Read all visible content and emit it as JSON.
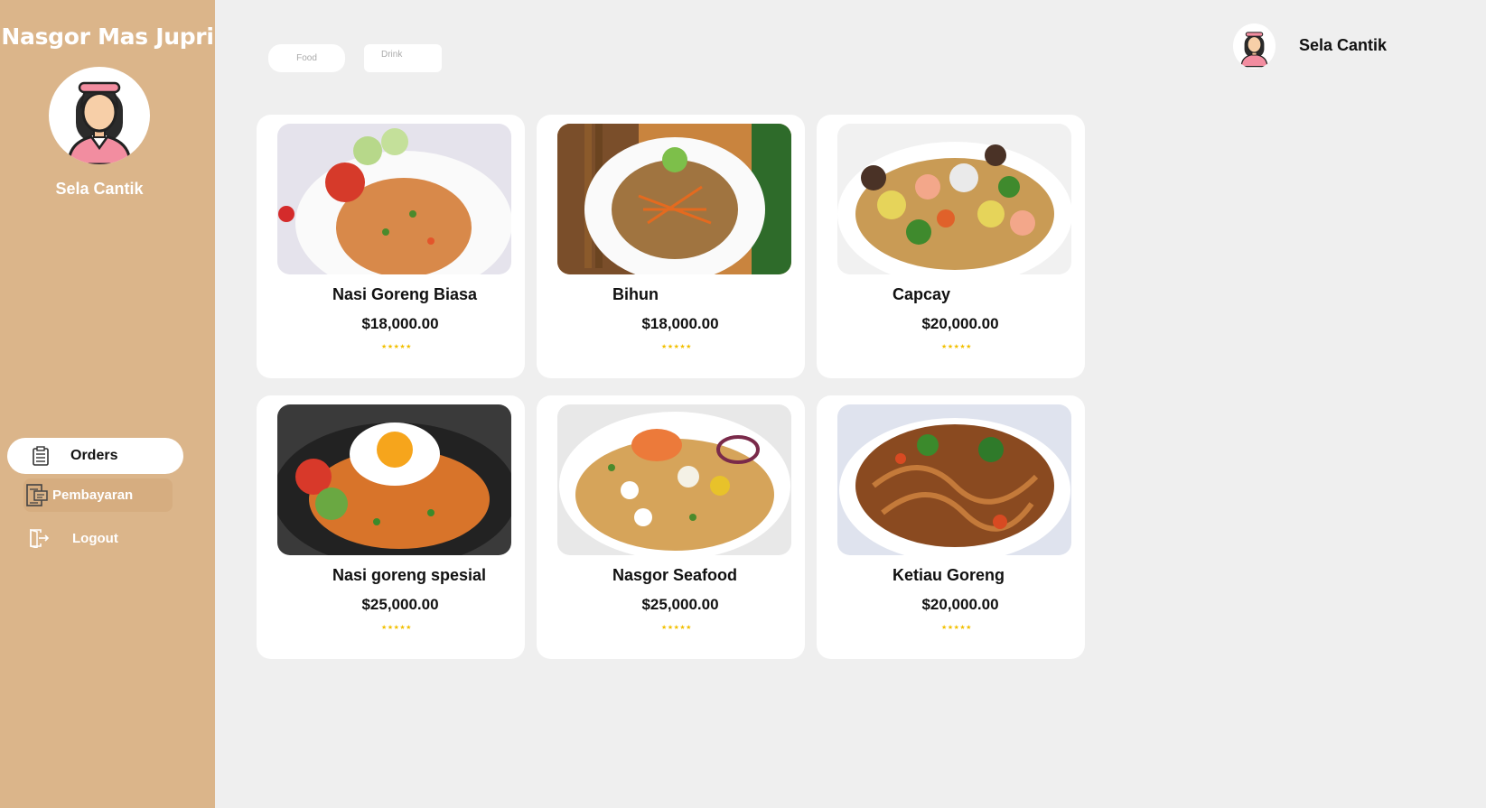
{
  "sidebar": {
    "app_title": "Nasgor Mas Jupri",
    "user_name": "Sela Cantik",
    "nav": [
      {
        "label": "Orders",
        "icon": "clipboard-icon"
      },
      {
        "label": "Pembayaran",
        "icon": "receipt-icon"
      },
      {
        "label": "Logout",
        "icon": "logout-icon"
      }
    ]
  },
  "filters": {
    "food": "Food",
    "drink": "Drink"
  },
  "header": {
    "user_name": "Sela Cantik"
  },
  "menu": [
    {
      "name": "Nasi Goreng Biasa",
      "price": "$18,000.00",
      "rating": "★★★★★",
      "image": "fried-rice-plate"
    },
    {
      "name": "Bihun",
      "price": "$18,000.00",
      "rating": "★★★★★",
      "image": "vermicelli-plate"
    },
    {
      "name": "Capcay",
      "price": "$20,000.00",
      "rating": "★★★★★",
      "image": "stir-fry-vegetables"
    },
    {
      "name": "Nasi goreng spesial",
      "price": "$25,000.00",
      "rating": "★★★★★",
      "image": "fried-rice-egg"
    },
    {
      "name": "Nasgor Seafood",
      "price": "$25,000.00",
      "rating": "★★★★★",
      "image": "seafood-fried-rice"
    },
    {
      "name": "Ketiau Goreng",
      "price": "$20,000.00",
      "rating": "★★★★★",
      "image": "fried-noodles"
    }
  ],
  "colors": {
    "sidebar": "#dbb58a",
    "background": "#efefef",
    "star": "#f2c000"
  }
}
